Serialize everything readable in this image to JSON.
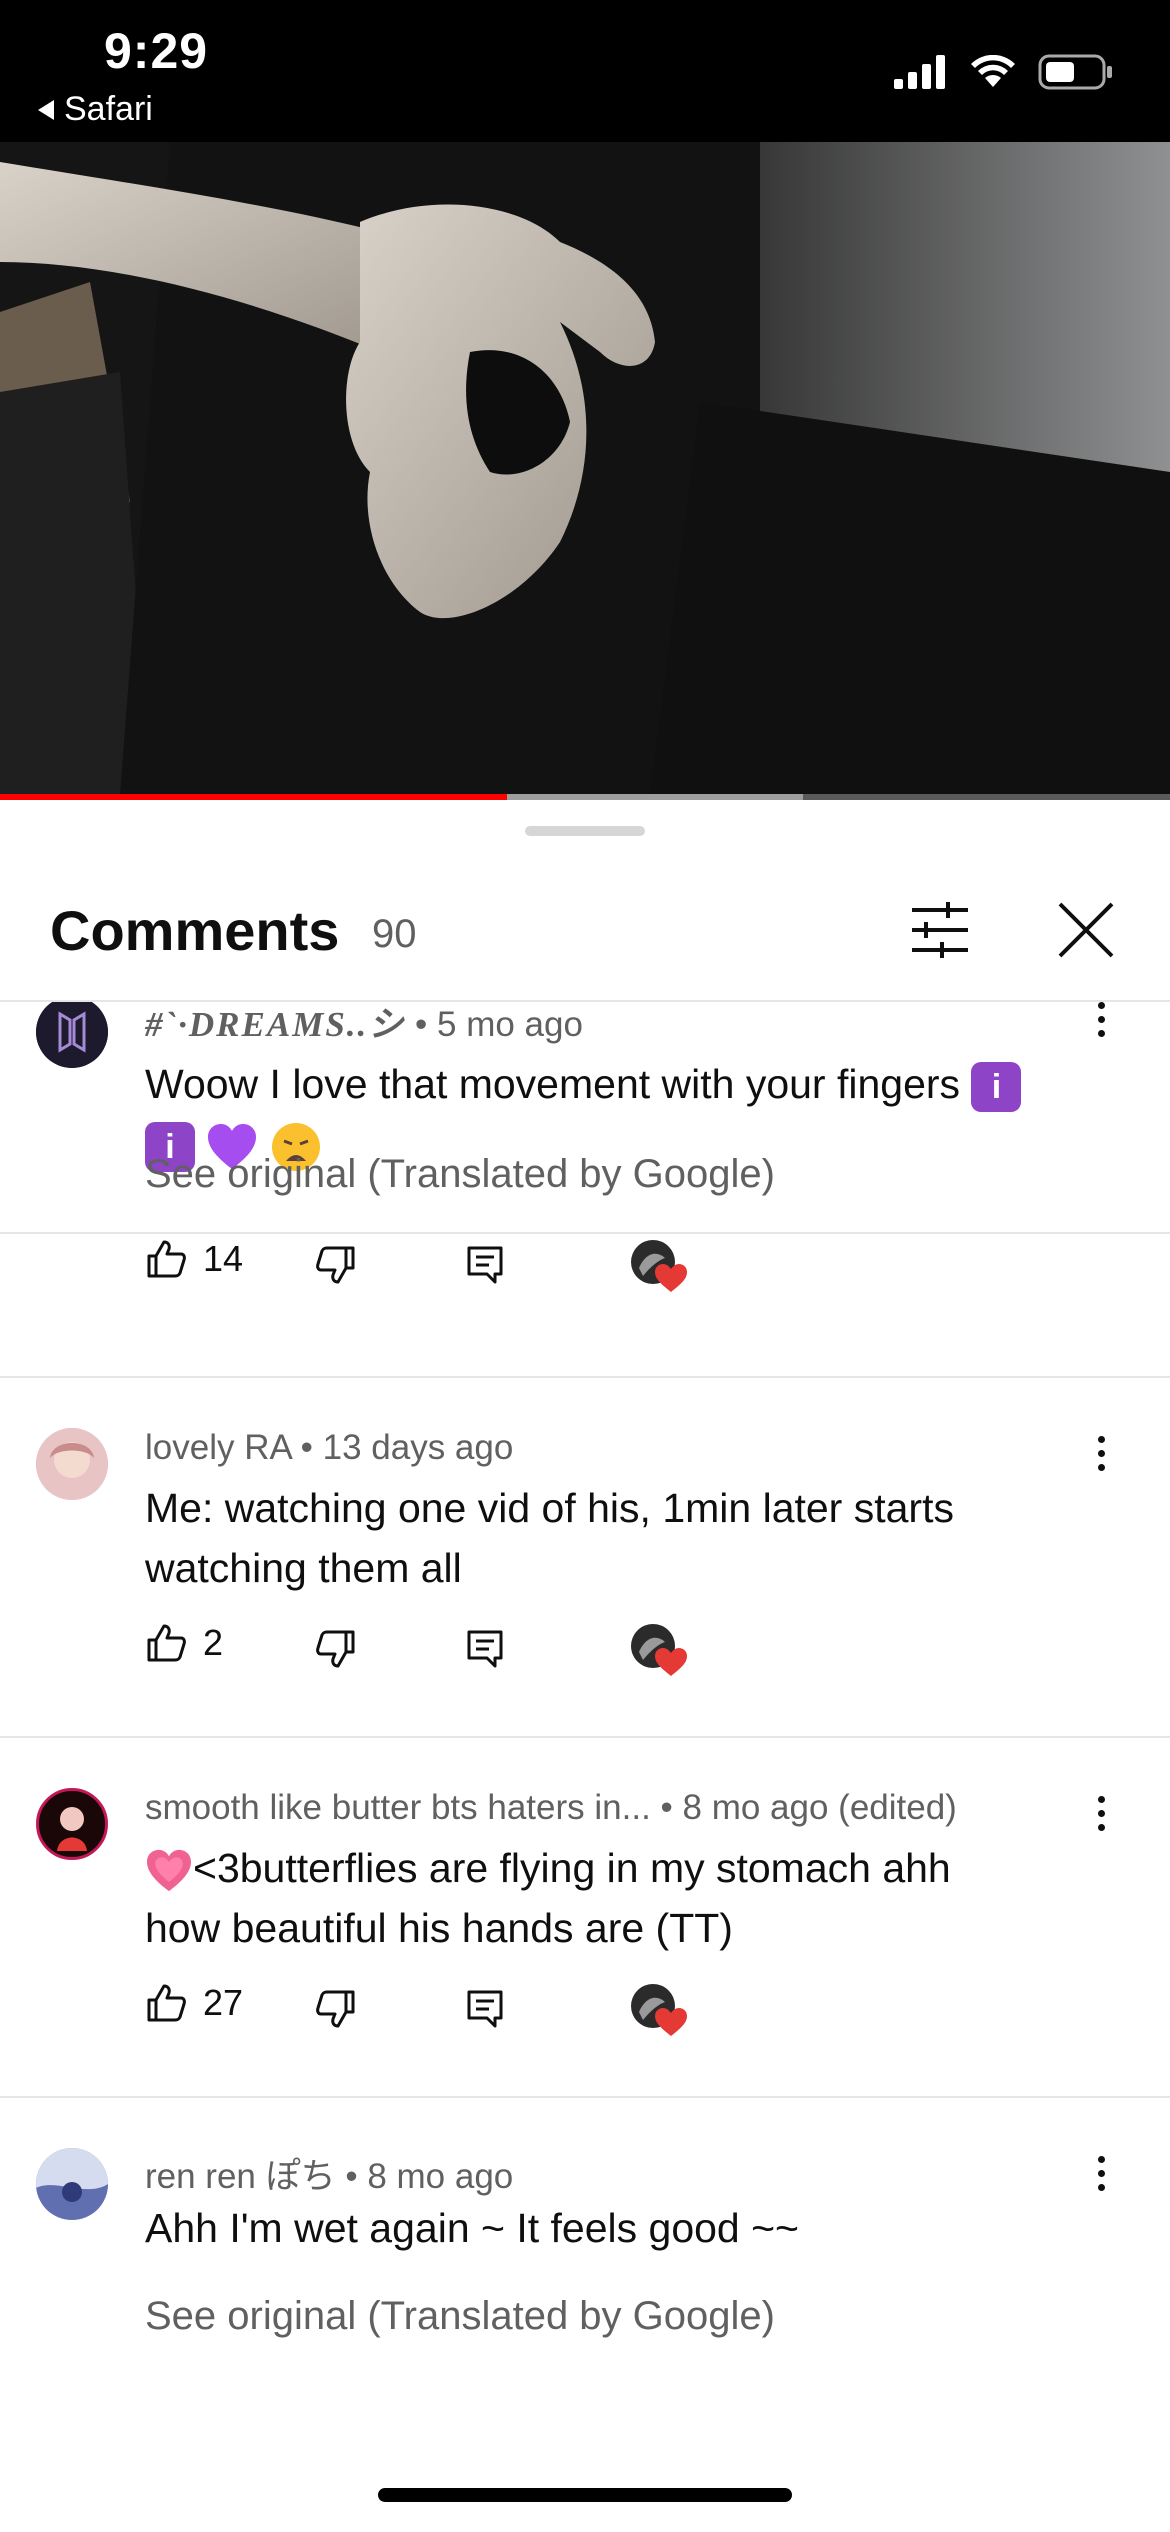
{
  "status_bar": {
    "time": "9:29",
    "back_app": "Safari"
  },
  "video": {
    "progress_played": 0.433,
    "progress_buffered": 0.686
  },
  "comments_panel": {
    "title": "Comments",
    "count": "90"
  },
  "comments": [
    {
      "author": "#`·DREAMS..シ",
      "time": "• 5 mo ago",
      "text": "Woow I love that movement with your fingers",
      "see_original": "See original (Translated by Google)",
      "likes": "14"
    },
    {
      "author": "lovely RA",
      "time": "• 13 days ago",
      "text_line1": "Me: watching one vid of his, 1min later starts",
      "text_line2": "watching them all",
      "likes": "2"
    },
    {
      "author": "smooth like butter bts haters in...",
      "time": "• 8 mo ago (edited)",
      "text_line1": "<3butterflies are flying in my stomach ahh",
      "text_line2": "how beautiful his hands are (TT)",
      "likes": "27"
    },
    {
      "author": "ren ren ぽち",
      "time": "• 8 mo ago",
      "text": "Ahh I'm wet again ~ It feels good ~~",
      "see_original": "See original (Translated by Google)"
    }
  ],
  "colors": {
    "accent_red": "#ff0000",
    "heart_red": "#e53935",
    "secondary_text": "#606060",
    "emoji_purple": "#8e44c7"
  }
}
